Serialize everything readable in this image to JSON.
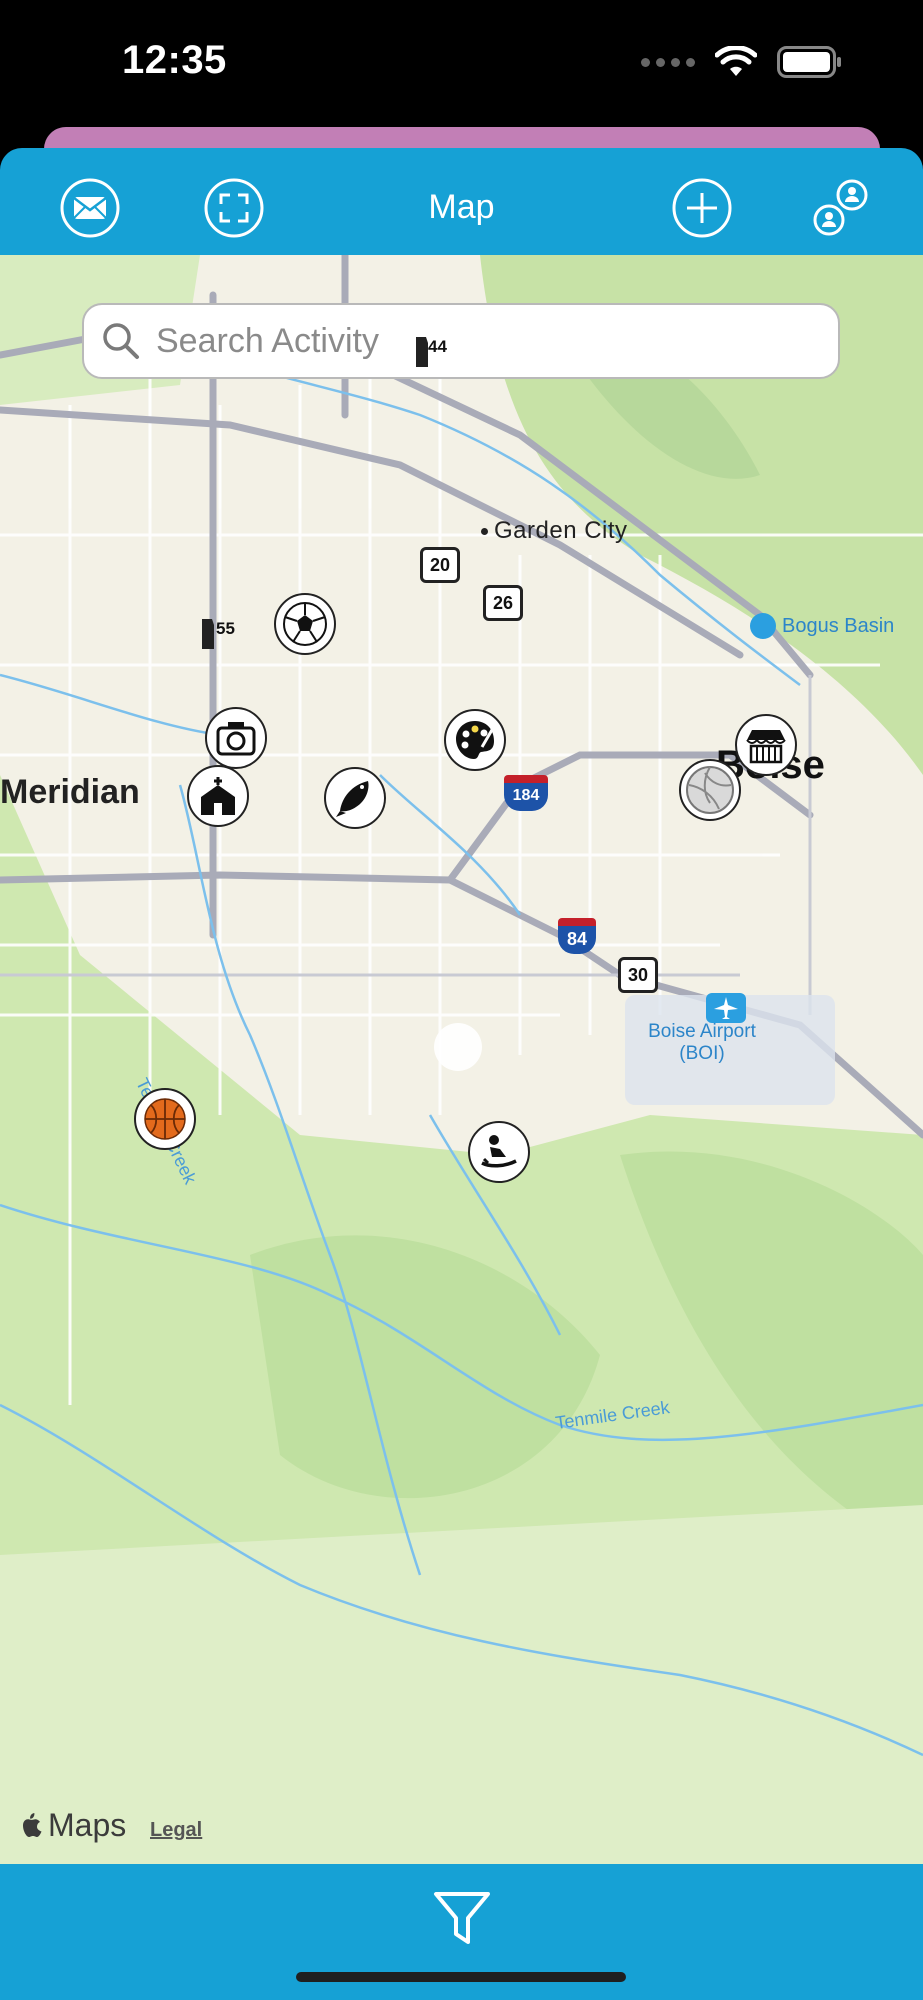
{
  "status_bar": {
    "time": "12:35"
  },
  "navbar": {
    "title": "Map",
    "buttons": [
      "mail-icon",
      "scan-icon",
      "add-icon",
      "people-icon"
    ]
  },
  "search": {
    "placeholder": "Search Activity"
  },
  "map": {
    "places": {
      "garden_city": "Garden City",
      "bogus_basin": "Bogus Basin",
      "meridian": "Meridian",
      "boise": "Boise",
      "airport_line1": "Boise Airport",
      "airport_line2": "(BOI)",
      "tenmile_creek_west": "Tenmile Creek",
      "tenmile_creek_south": "Tenmile Creek"
    },
    "routes": {
      "id44": "44",
      "us20": "20",
      "us26": "26",
      "id55": "55",
      "i184": "184",
      "i84": "84",
      "us30": "30"
    },
    "pins": [
      "soccer-ball-icon",
      "camera-icon",
      "art-palette-icon",
      "church-icon",
      "fish-icon",
      "market-stand-icon",
      "volleyball-icon",
      "basketball-icon",
      "sledding-icon"
    ],
    "attribution": {
      "logo": "Maps",
      "legal": "Legal"
    }
  },
  "bottom_bar": {
    "button": "filter-icon"
  }
}
